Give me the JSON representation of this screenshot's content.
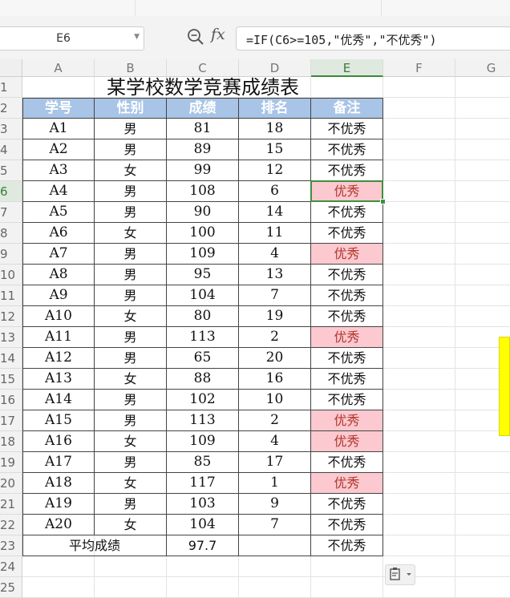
{
  "name_box": "E6",
  "formula_bar": {
    "fx_label": "fx",
    "formula": "=IF(C6>=105,\"优秀\",\"不优秀\")"
  },
  "column_headers": [
    "A",
    "B",
    "C",
    "D",
    "E",
    "F",
    "G"
  ],
  "selected_column": "E",
  "selected_row": 6,
  "row_numbers": [
    "1",
    "2",
    "3",
    "4",
    "5",
    "6",
    "7",
    "8",
    "9",
    "10",
    "11",
    "12",
    "13",
    "14",
    "15",
    "16",
    "17",
    "18",
    "19",
    "20",
    "21",
    "22",
    "23",
    "24",
    "25"
  ],
  "sheet": {
    "title": "某学校数学竞赛成绩表",
    "headers": [
      "学号",
      "性别",
      "成绩",
      "排名",
      "备注"
    ],
    "rows": [
      [
        "A1",
        "男",
        "81",
        "18",
        "不优秀"
      ],
      [
        "A2",
        "男",
        "89",
        "15",
        "不优秀"
      ],
      [
        "A3",
        "女",
        "99",
        "12",
        "不优秀"
      ],
      [
        "A4",
        "男",
        "108",
        "6",
        "优秀"
      ],
      [
        "A5",
        "男",
        "90",
        "14",
        "不优秀"
      ],
      [
        "A6",
        "女",
        "100",
        "11",
        "不优秀"
      ],
      [
        "A7",
        "男",
        "109",
        "4",
        "优秀"
      ],
      [
        "A8",
        "男",
        "95",
        "13",
        "不优秀"
      ],
      [
        "A9",
        "男",
        "104",
        "7",
        "不优秀"
      ],
      [
        "A10",
        "女",
        "80",
        "19",
        "不优秀"
      ],
      [
        "A11",
        "男",
        "113",
        "2",
        "优秀"
      ],
      [
        "A12",
        "男",
        "65",
        "20",
        "不优秀"
      ],
      [
        "A13",
        "女",
        "88",
        "16",
        "不优秀"
      ],
      [
        "A14",
        "男",
        "102",
        "10",
        "不优秀"
      ],
      [
        "A15",
        "男",
        "113",
        "2",
        "优秀"
      ],
      [
        "A16",
        "女",
        "109",
        "4",
        "优秀"
      ],
      [
        "A17",
        "男",
        "85",
        "17",
        "不优秀"
      ],
      [
        "A18",
        "女",
        "117",
        "1",
        "优秀"
      ],
      [
        "A19",
        "男",
        "103",
        "9",
        "不优秀"
      ],
      [
        "A20",
        "女",
        "104",
        "7",
        "不优秀"
      ]
    ],
    "average_label": "平均成绩",
    "average_value": "97.7",
    "average_remark": "不优秀"
  },
  "colors": {
    "header_fill": "#a8c4e6",
    "highlight_fill": "#fbc9cf",
    "highlight_text": "#b1352d",
    "selection": "#3f8f3f",
    "side_marker": "#ffff00"
  },
  "icons": {
    "zoom": "zoom-formula-icon",
    "paste_options": "paste-options-icon",
    "name_box_dropdown": "chevron-down-icon"
  }
}
